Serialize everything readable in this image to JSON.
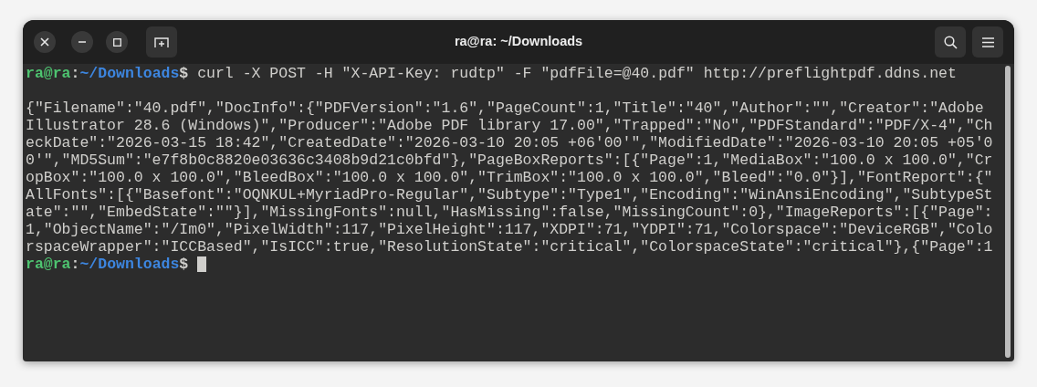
{
  "window": {
    "title": "ra@ra: ~/Downloads"
  },
  "terminal": {
    "lines": [
      {
        "kind": "prompt",
        "user_host": "ra@ra",
        "separator": ":",
        "path": "~/Downloads",
        "symbol": "$",
        "command": " curl -X POST -H \"X-API-Key: rudtp\" -F \"pdfFile=@40.pdf\" http://preflightpdf.ddns.net",
        "cursor": false
      },
      {
        "kind": "blank"
      },
      {
        "kind": "output",
        "text": "{\"Filename\":\"40.pdf\",\"DocInfo\":{\"PDFVersion\":\"1.6\",\"PageCount\":1,\"Title\":\"40\",\"Author\":\"\",\"Creator\":\"Adobe"
      },
      {
        "kind": "output",
        "text": "Illustrator 28.6 (Windows)\",\"Producer\":\"Adobe PDF library 17.00\",\"Trapped\":\"No\",\"PDFStandard\":\"PDF/X-4\",\"Ch"
      },
      {
        "kind": "output",
        "text": "eckDate\":\"2026-03-15 18:42\",\"CreatedDate\":\"2026-03-10 20:05 +06'00'\",\"ModifiedDate\":\"2026-03-10 20:05 +05'0"
      },
      {
        "kind": "output",
        "text": "0'\",\"MD5Sum\":\"e7f8b0c8820e03636c3408b9d21c0bfd\"},\"PageBoxReports\":[{\"Page\":1,\"MediaBox\":\"100.0 x 100.0\",\"Cr"
      },
      {
        "kind": "output",
        "text": "opBox\":\"100.0 x 100.0\",\"BleedBox\":\"100.0 x 100.0\",\"TrimBox\":\"100.0 x 100.0\",\"Bleed\":\"0.0\"}],\"FontReport\":{\""
      },
      {
        "kind": "output",
        "text": "AllFonts\":[{\"Basefont\":\"OQNKUL+MyriadPro-Regular\",\"Subtype\":\"Type1\",\"Encoding\":\"WinAnsiEncoding\",\"SubtypeSt"
      },
      {
        "kind": "output",
        "text": "ate\":\"\",\"EmbedState\":\"\"}],\"MissingFonts\":null,\"HasMissing\":false,\"MissingCount\":0},\"ImageReports\":[{\"Page\":"
      },
      {
        "kind": "output",
        "text": "1,\"ObjectName\":\"/Im0\",\"PixelWidth\":117,\"PixelHeight\":117,\"XDPI\":71,\"YDPI\":71,\"Colorspace\":\"DeviceRGB\",\"Colo"
      },
      {
        "kind": "output",
        "text": "rspaceWrapper\":\"ICCBased\",\"IsICC\":true,\"ResolutionState\":\"critical\",\"ColorspaceState\":\"critical\"},{\"Page\":1"
      },
      {
        "kind": "prompt",
        "user_host": "ra@ra",
        "separator": ":",
        "path": "~/Downloads",
        "symbol": "$",
        "cursor": true
      }
    ]
  }
}
